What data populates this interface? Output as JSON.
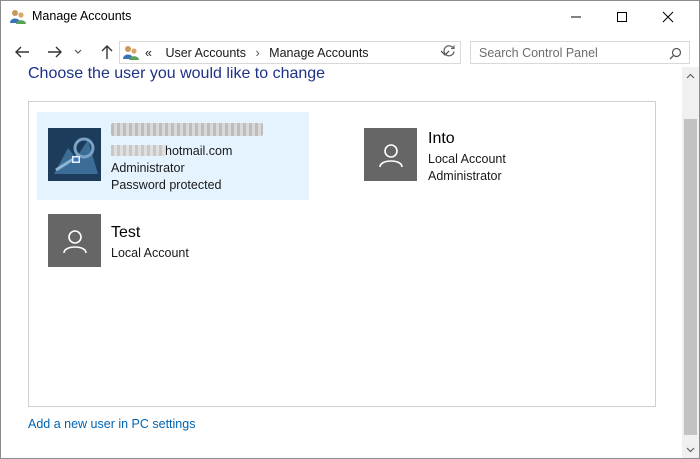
{
  "window": {
    "title": "Manage Accounts",
    "app_icon": "user-accounts-icon"
  },
  "navigation": {
    "back_icon": "arrow-left-icon",
    "forward_icon": "arrow-right-icon",
    "up_icon": "arrow-up-icon",
    "breadcrumb": {
      "overflow": "«",
      "items": [
        "User Accounts",
        "Manage Accounts"
      ],
      "separator": "›"
    },
    "search_placeholder": "Search Control Panel"
  },
  "main": {
    "heading": "Choose the user you would like to change",
    "accounts": [
      {
        "name_redacted": true,
        "email_visible": "otmail.com",
        "email_prefix_char": "h",
        "lines": [
          "Administrator",
          "Password protected"
        ],
        "selected": true
      },
      {
        "name": "Into",
        "lines": [
          "Local Account",
          "Administrator"
        ],
        "selected": false
      },
      {
        "name": "Test",
        "lines": [
          "Local Account"
        ],
        "selected": false
      }
    ],
    "add_user_link": "Add a new user in PC settings"
  },
  "colors": {
    "heading": "#1e3287",
    "link": "#0063b1",
    "selected_tile": "#e5f3ff",
    "avatar_bg": "#666666"
  }
}
